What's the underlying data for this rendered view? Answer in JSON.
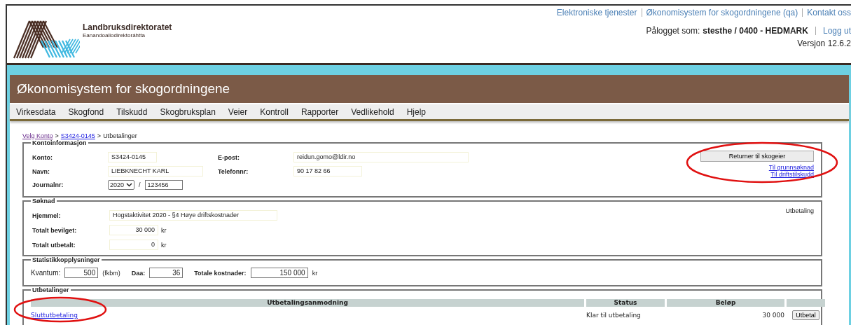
{
  "header": {
    "org_name": "Landbruksdirektoratet",
    "org_subtitle": "Eanandoallodirektoráhtta",
    "top_links": [
      "Elektroniske tjenester",
      "Økonomisystem for skogordningene (qa)",
      "Kontakt oss"
    ],
    "login_label": "Pålogget som:",
    "login_user": "stesthe / 0400 - HEDMARK",
    "logout": "Logg ut",
    "version": "Versjon 12.6.2"
  },
  "app_title": "Økonomisystem for skogordningene",
  "menu": [
    "Virkesdata",
    "Skogfond",
    "Tilskudd",
    "Skogbruksplan",
    "Veier",
    "Kontroll",
    "Rapporter",
    "Vedlikehold",
    "Hjelp"
  ],
  "breadcrumb_separator": ">",
  "breadcrumb": [
    {
      "label": "Velg Konto",
      "kind": "visited"
    },
    {
      "label": "S3424-0145",
      "kind": "link"
    },
    {
      "label": "Utbetalinger",
      "kind": "current"
    }
  ],
  "kontoinformasjon": {
    "legend": "Kontoinformasjon",
    "rows": [
      [
        {
          "label": "Konto:",
          "value": "S3424-0145"
        },
        {
          "label": "E-post:",
          "value": "reidun.gomo@ldir.no"
        }
      ],
      [
        {
          "label": "Navn:",
          "value": "LIEBKNECHT KARL"
        },
        {
          "label": "Telefonnr:",
          "value": "90 17 82 66"
        }
      ]
    ],
    "journal": {
      "label": "Journalnr:",
      "year": "2020",
      "separator": "/",
      "number": "123456"
    },
    "button": "Returner til skogeier",
    "links": [
      "Til grunnsøknad",
      "Til driftstilskudd"
    ]
  },
  "soknad": {
    "legend": "Søknad",
    "side_text": "Utbetaling",
    "rows": [
      {
        "label": "Hjemmel:",
        "value": "Hogstaktivitet 2020 - §4 Høye driftskostnader",
        "kind": "text"
      },
      {
        "label": "Totalt bevilget:",
        "value": "30 000",
        "unit": "kr",
        "kind": "amount"
      },
      {
        "label": "Totalt utbetalt:",
        "value": "0",
        "unit": "kr",
        "kind": "amount"
      }
    ]
  },
  "statistikk": {
    "legend": "Statistikkopplysninger",
    "fields": [
      {
        "label": "Kvantum:",
        "value": "500",
        "unit": "(fkbm)"
      },
      {
        "label": "Daa:",
        "value": "36"
      },
      {
        "label": "Totale kostnader:",
        "value": "150 000",
        "unit": "kr"
      }
    ]
  },
  "utbetalinger": {
    "legend": "Utbetalinger",
    "columns": [
      "Utbetalingsanmodning",
      "Status",
      "Beløp"
    ],
    "rows": [
      {
        "request": "Sluttutbetaling",
        "status": "Klar til utbetaling",
        "amount": "30 000",
        "action": "Utbetal"
      }
    ]
  }
}
